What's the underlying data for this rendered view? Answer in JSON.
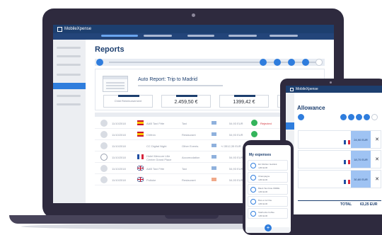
{
  "laptop": {
    "app_name": "MobileXpense",
    "page_title": "Reports",
    "report": {
      "title": "Auto Report: Trip to Madrid",
      "stats": [
        {
          "value": "",
          "label": "Child Reimbursement"
        },
        {
          "value": "2.459,50 €",
          "label": ""
        },
        {
          "value": "1399,42 €",
          "label": ""
        }
      ]
    },
    "rows": [
      {
        "date": "11/10/2018",
        "name": "AAB Taxi Fête",
        "category": "Taxi",
        "amount": "54,93 EUR",
        "status": "Rejected",
        "flag": "es"
      },
      {
        "date": "11/10/2018",
        "name": "Chifrón",
        "category": "Restaurant",
        "amount": "54,93 EUR",
        "status": "",
        "flag": "es"
      },
      {
        "date": "11/10/2018",
        "name": "CC Digital Night",
        "category": "Other Events",
        "amount": "+/-3512,35 EUR",
        "status": "",
        "flag": "none"
      },
      {
        "date": "11/10/2018",
        "name": "Hotel Mercure Lille Centre Grand Place",
        "category": "Accomodation",
        "amount": "54,93 EUR",
        "status": "",
        "flag": "fr"
      },
      {
        "date": "11/10/2018",
        "name": "AAB Taxi Fête",
        "category": "Taxi",
        "amount": "54,93 EUR",
        "status": "",
        "flag": "uk"
      },
      {
        "date": "11/10/2018",
        "name": "Potluke",
        "category": "Restaurant",
        "amount": "54,93 EUR",
        "status": "",
        "flag": "uk"
      }
    ]
  },
  "tablet": {
    "app_name": "MobileXpense",
    "heading": "Allowance",
    "rows": [
      {
        "amount": "24,90 EUR"
      },
      {
        "amount": "18,70 EUR"
      },
      {
        "amount": "30,80 EUR"
      }
    ],
    "total_label": "TOTAL",
    "total_value": "63,25 EUR"
  },
  "phone": {
    "heading": "My expenses",
    "items": [
      {
        "title": "Ein Muhlen Getränk",
        "amount": "4,80 EUR"
      },
      {
        "title": "Champagne",
        "amount": "4,80 EUR"
      },
      {
        "title": "Black Taxi Fête WRRE",
        "amount": "4,80 EUR"
      },
      {
        "title": "Bois et la Frite",
        "amount": "4,80 EUR"
      },
      {
        "title": "Starbucks Coffee",
        "amount": "4,80 EUR"
      }
    ],
    "fab": "+"
  }
}
